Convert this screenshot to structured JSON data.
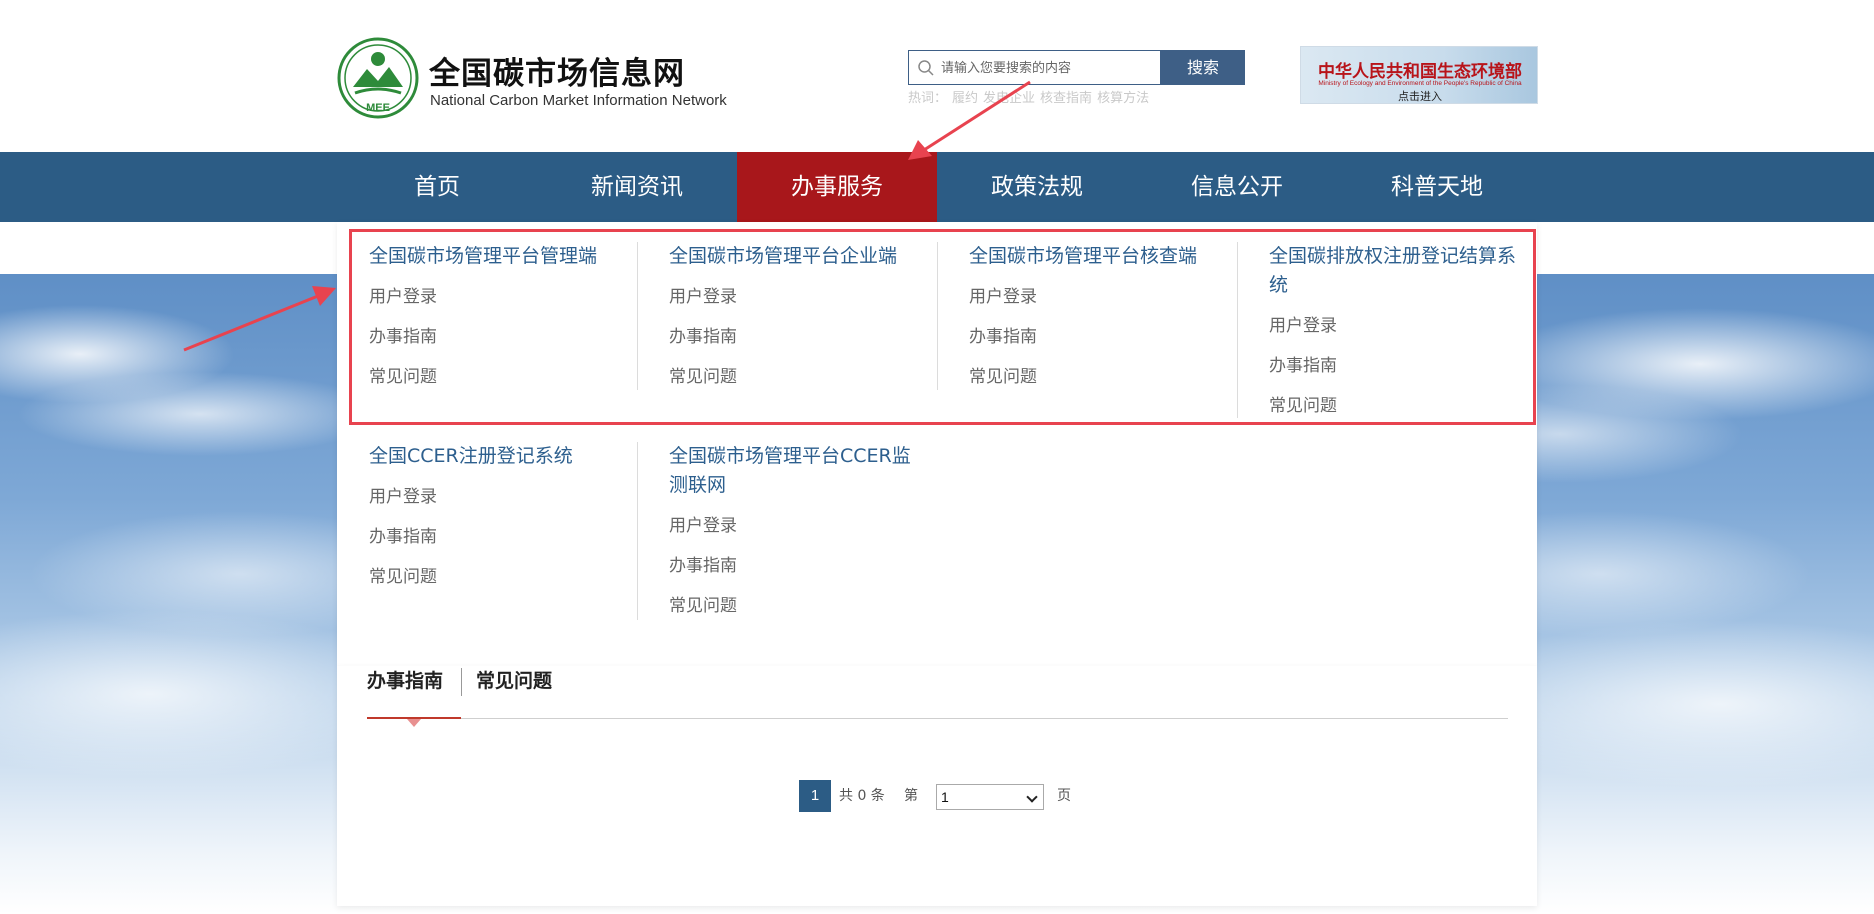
{
  "header": {
    "title": "全国碳市场信息网",
    "subtitle": "National Carbon Market Information Network",
    "logo_text": "MEE"
  },
  "search": {
    "placeholder": "请输入您要搜索的内容",
    "button_label": "搜索",
    "hotwords_label": "热词：",
    "hotwords": [
      "履约",
      "发电企业",
      "核查指南",
      "核算方法"
    ]
  },
  "ministry_banner": {
    "name": "中华人民共和国生态环境部",
    "english": "Ministry of Ecology and Environment of the People's Republic of China",
    "enter_label": "点击进入"
  },
  "nav": {
    "items": [
      {
        "label": "首页"
      },
      {
        "label": "新闻资讯"
      },
      {
        "label": "办事服务"
      },
      {
        "label": "政策法规"
      },
      {
        "label": "信息公开"
      },
      {
        "label": "科普天地"
      }
    ],
    "active": "办事服务"
  },
  "dropdown": {
    "columns": [
      {
        "title": "全国碳市场管理平台管理端",
        "links": [
          "用户登录",
          "办事指南",
          "常见问题"
        ]
      },
      {
        "title": "全国碳市场管理平台企业端",
        "links": [
          "用户登录",
          "办事指南",
          "常见问题"
        ]
      },
      {
        "title": "全国碳市场管理平台核查端",
        "links": [
          "用户登录",
          "办事指南",
          "常见问题"
        ]
      },
      {
        "title": "全国碳排放权注册登记结算系统",
        "title_line1": "全国碳排放权注册登记结算系",
        "title_line2": "统",
        "links": [
          "用户登录",
          "办事指南",
          "常见问题"
        ]
      },
      {
        "title": "全国CCER注册登记系统",
        "links": [
          "用户登录",
          "办事指南",
          "常见问题"
        ]
      },
      {
        "title": "全国碳市场管理平台CCER监测联网",
        "title_line1": "全国碳市场管理平台CCER监",
        "title_line2": "测联网",
        "links": [
          "用户登录",
          "办事指南",
          "常见问题"
        ]
      }
    ]
  },
  "content": {
    "tabs": [
      {
        "label": "办事指南"
      },
      {
        "label": "常见问题"
      }
    ],
    "active_tab": "办事指南"
  },
  "pagination": {
    "current_page": "1",
    "total_label": "共 0 条",
    "page_prefix": "第",
    "select_value": "1",
    "page_suffix": "页"
  },
  "colors": {
    "nav_bg": "#2c5c85",
    "nav_active": "#a8171b",
    "link_title": "#2d5f8e",
    "annotation": "#e8434f"
  }
}
